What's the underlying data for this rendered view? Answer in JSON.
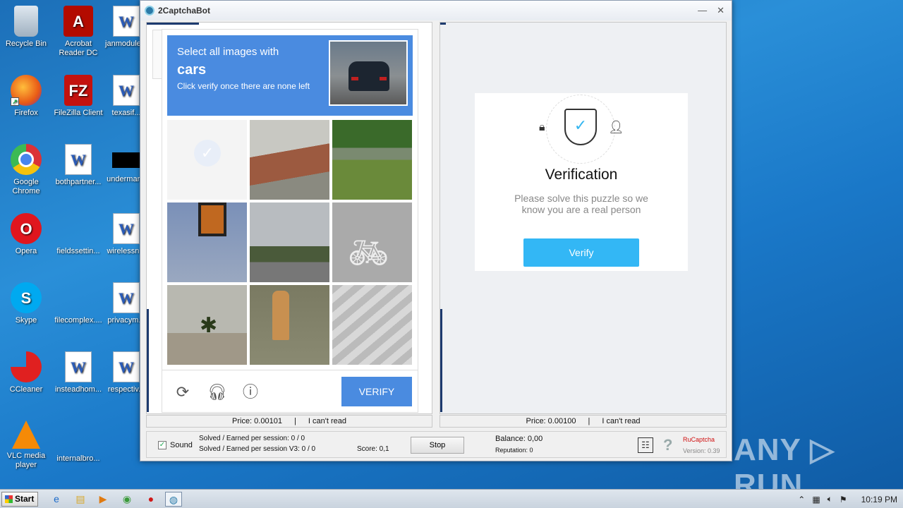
{
  "desktop": {
    "icons": [
      {
        "label": "Recycle Bin",
        "icon": "recycle-bin-icon"
      },
      {
        "label": "Acrobat Reader DC",
        "icon": "acrobat-icon"
      },
      {
        "label": "janmodule...",
        "icon": "word-doc-icon"
      },
      {
        "label": "Firefox",
        "icon": "firefox-icon"
      },
      {
        "label": "FileZilla Client",
        "icon": "filezilla-icon"
      },
      {
        "label": "texasif...",
        "icon": "word-doc-icon"
      },
      {
        "label": "Google Chrome",
        "icon": "chrome-icon"
      },
      {
        "label": "bothpartner...",
        "icon": "word-doc-icon"
      },
      {
        "label": "undermar...",
        "icon": "black-file-icon"
      },
      {
        "label": "Opera",
        "icon": "opera-icon"
      },
      {
        "label": "fieldssettin...",
        "icon": "blank-file-icon"
      },
      {
        "label": "wirelessn...",
        "icon": "word-doc-icon"
      },
      {
        "label": "Skype",
        "icon": "skype-icon"
      },
      {
        "label": "filecomplex....",
        "icon": "blank-file-icon"
      },
      {
        "label": "privacym...",
        "icon": "word-doc-icon"
      },
      {
        "label": "CCleaner",
        "icon": "ccleaner-icon"
      },
      {
        "label": "insteadhom...",
        "icon": "word-doc-icon"
      },
      {
        "label": "respectiv...",
        "icon": "word-doc-icon"
      },
      {
        "label": "VLC media player",
        "icon": "vlc-icon"
      },
      {
        "label": "internalbro...",
        "icon": "blank-file-icon"
      }
    ]
  },
  "window": {
    "title": "2CaptchaBot",
    "minimize": "—",
    "close": "✕"
  },
  "captcha": {
    "line1": "Select all images with",
    "target": "cars",
    "line3": "Click verify once there are none left",
    "verify_label": "VERIFY",
    "tiles": [
      "checked",
      "roof",
      "road-car",
      "traffic-light",
      "street",
      "bike-lane",
      "palm",
      "hydrant",
      "crosswalk"
    ]
  },
  "verification": {
    "title": "Verification",
    "description": "Please solve this puzzle so we know you are a real person",
    "button": "Verify"
  },
  "left_status": {
    "price": "Price: 0.00101",
    "sep": "|",
    "cant_read": "I can't read"
  },
  "right_status": {
    "price": "Price: 0.00100",
    "sep": "|",
    "cant_read": "I can't read"
  },
  "bottom": {
    "sound_label": "Sound",
    "solved1": "Solved / Earned per session: 0 / 0",
    "solved2": "Solved / Earned per session V3: 0 / 0",
    "score": "Score: 0,1",
    "stop": "Stop",
    "balance": "Balance:  0,00",
    "reputation": "Reputation: 0",
    "service": "RuCaptcha",
    "version": "Version: 0.39"
  },
  "watermark": "ANY ▷ RUN",
  "taskbar": {
    "start": "Start",
    "time": "10:19 PM"
  },
  "colors": {
    "accent": "#4a8be0",
    "verify": "#33b7f5"
  }
}
